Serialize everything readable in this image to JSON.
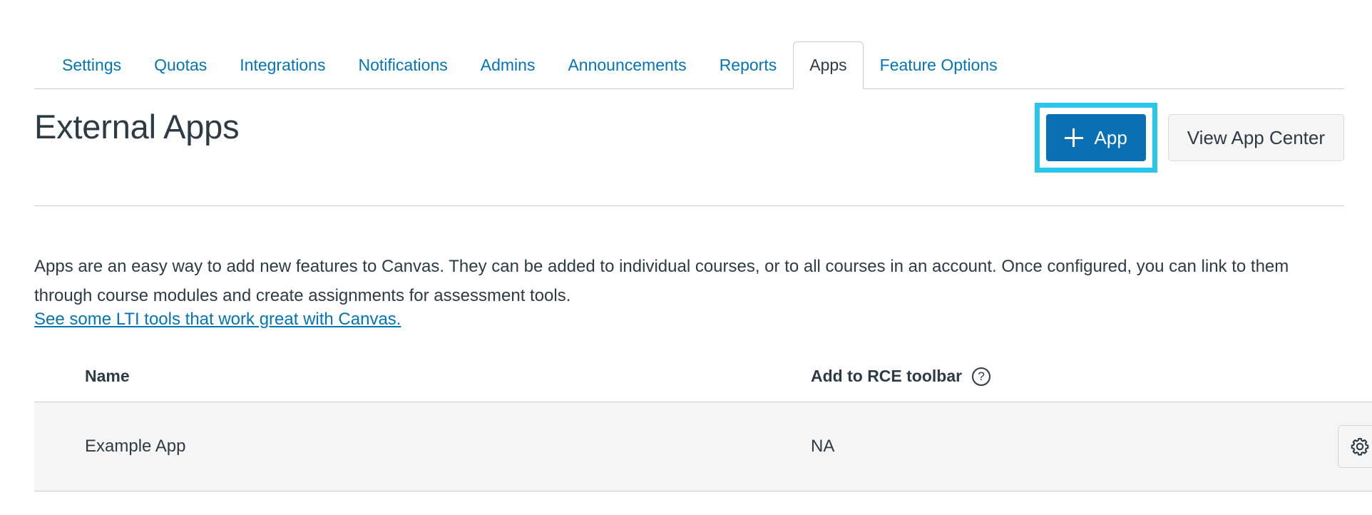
{
  "tabs": [
    {
      "label": "Settings",
      "active": false
    },
    {
      "label": "Quotas",
      "active": false
    },
    {
      "label": "Integrations",
      "active": false
    },
    {
      "label": "Notifications",
      "active": false
    },
    {
      "label": "Admins",
      "active": false
    },
    {
      "label": "Announcements",
      "active": false
    },
    {
      "label": "Reports",
      "active": false
    },
    {
      "label": "Apps",
      "active": true
    },
    {
      "label": "Feature Options",
      "active": false
    }
  ],
  "page": {
    "title": "External Apps",
    "description": "Apps are an easy way to add new features to Canvas. They can be added to individual courses, or to all courses in an account. Once configured, you can link to them through course modules and create assignments for assessment tools.",
    "lti_link": "See some LTI tools that work great with Canvas."
  },
  "actions": {
    "add_app_label": "App",
    "add_app_icon": "plus-icon",
    "view_app_center_label": "View App Center",
    "highlight_color": "#29c5ea",
    "primary_color": "#0a70b3"
  },
  "table": {
    "headers": {
      "name": "Name",
      "rce": "Add to RCE toolbar",
      "rce_help_icon": "?"
    },
    "rows": [
      {
        "name": "Example App",
        "rce": "NA",
        "settings_icon": "gear-icon"
      }
    ]
  }
}
